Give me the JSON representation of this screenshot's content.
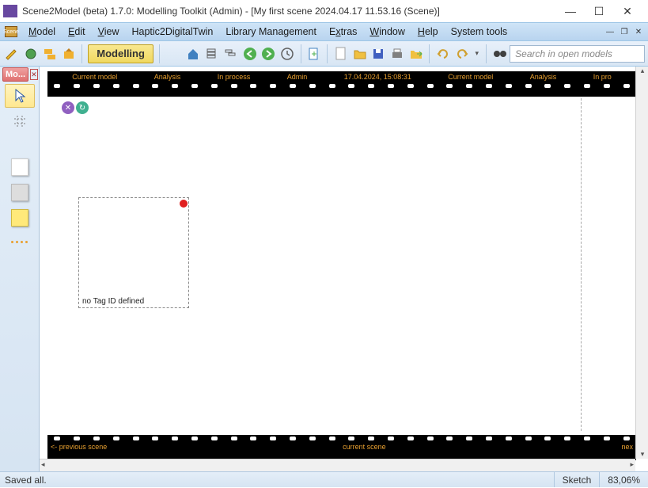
{
  "window": {
    "title": "Scene2Model (beta) 1.7.0: Modelling Toolkit (Admin) - [My first scene 2024.04.17 11.53.16 (Scene)]"
  },
  "menu": {
    "model": "Model",
    "edit": "Edit",
    "view": "View",
    "haptic": "Haptic2DigitalTwin",
    "library": "Library Management",
    "extras": "Extras",
    "window": "Window",
    "help": "Help",
    "system": "System tools"
  },
  "toolbar": {
    "mode": "Modelling",
    "search_placeholder": "Search in open models"
  },
  "left_panel": {
    "tab": "Mo..."
  },
  "film": {
    "top": [
      "Current model",
      "Analysis",
      "In process",
      "Admin",
      "17.04.2024, 15:08:31",
      "Current model",
      "Analysis",
      "In pro"
    ],
    "bottom": [
      "<- previous scene",
      "current scene",
      "nex"
    ]
  },
  "canvas": {
    "box_label": "no Tag ID defined"
  },
  "status": {
    "left": "Saved all.",
    "mode": "Sketch",
    "zoom": "83,06%"
  }
}
